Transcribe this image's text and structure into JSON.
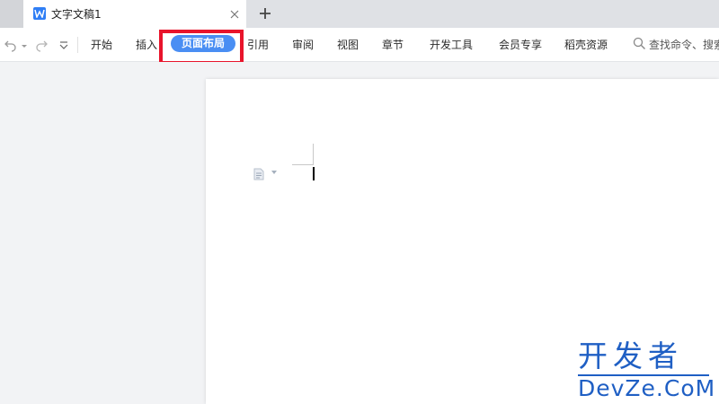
{
  "tabbar": {
    "document_tab_title": "文字文稿1",
    "icons": {
      "document": "wps-writer-icon",
      "close": "close-icon",
      "new_tab": "plus-icon"
    }
  },
  "toolbar": {
    "quick_access": [
      "undo-icon",
      "redo-icon",
      "customize-dropdown-icon"
    ],
    "menu": [
      {
        "label": "开始",
        "active": false
      },
      {
        "label": "插入",
        "active": false
      },
      {
        "label": "页面布局",
        "active": true
      },
      {
        "label": "引用",
        "active": false
      },
      {
        "label": "审阅",
        "active": false
      },
      {
        "label": "视图",
        "active": false
      },
      {
        "label": "章节",
        "active": false
      },
      {
        "label": "开发工具",
        "active": false
      },
      {
        "label": "会员专享",
        "active": false
      },
      {
        "label": "稻壳资源",
        "active": false
      }
    ],
    "search_placeholder": "查找命令、搜索"
  },
  "colors": {
    "accent": "#4a8ef3",
    "highlight_border": "#e8142b",
    "watermark": "#1f5fc4"
  },
  "watermark": {
    "line1": "开发者",
    "line2": "DevZe.CoM"
  }
}
